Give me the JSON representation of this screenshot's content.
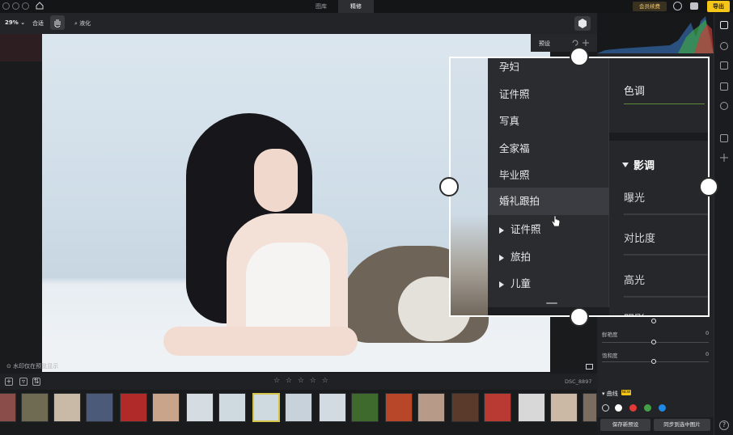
{
  "titlebar": {
    "tabs": [
      "图库",
      "精修"
    ],
    "vip_label": "会员续费",
    "export_label": "导出"
  },
  "toolbar": {
    "zoom": "29%",
    "fit_label": "合适",
    "liquefy_label": "液化"
  },
  "canvas": {
    "watermark_note": "水印仅在预览显示"
  },
  "preset_panel": {
    "label": "预设"
  },
  "menu": {
    "items": [
      "孕妇",
      "证件照",
      "写真",
      "全家福",
      "毕业照",
      "婚礼跟拍"
    ],
    "groups": [
      "证件照",
      "旅拍",
      "儿童"
    ],
    "hovered": "婚礼跟拍"
  },
  "zoom_panel": {
    "color_label": "色调",
    "tone_section": "影调",
    "sliders": [
      "曝光",
      "对比度",
      "高光",
      "阴影"
    ]
  },
  "adjustments": {
    "sliders": [
      {
        "label": "鲜艳度",
        "value": "0"
      },
      {
        "label": "饱和度",
        "value": "0"
      }
    ],
    "curve_label": "曲线",
    "curve_badge": "NEW",
    "channels": [
      "#ffffff",
      "#e53935",
      "#43a047",
      "#1e88e5"
    ]
  },
  "filmstrip": {
    "filename": "DSC_8897",
    "stars": "☆ ☆ ☆ ☆ ☆"
  },
  "bottom": {
    "save_preset": "保存新预设",
    "sync_label": "同步到选中图片"
  }
}
